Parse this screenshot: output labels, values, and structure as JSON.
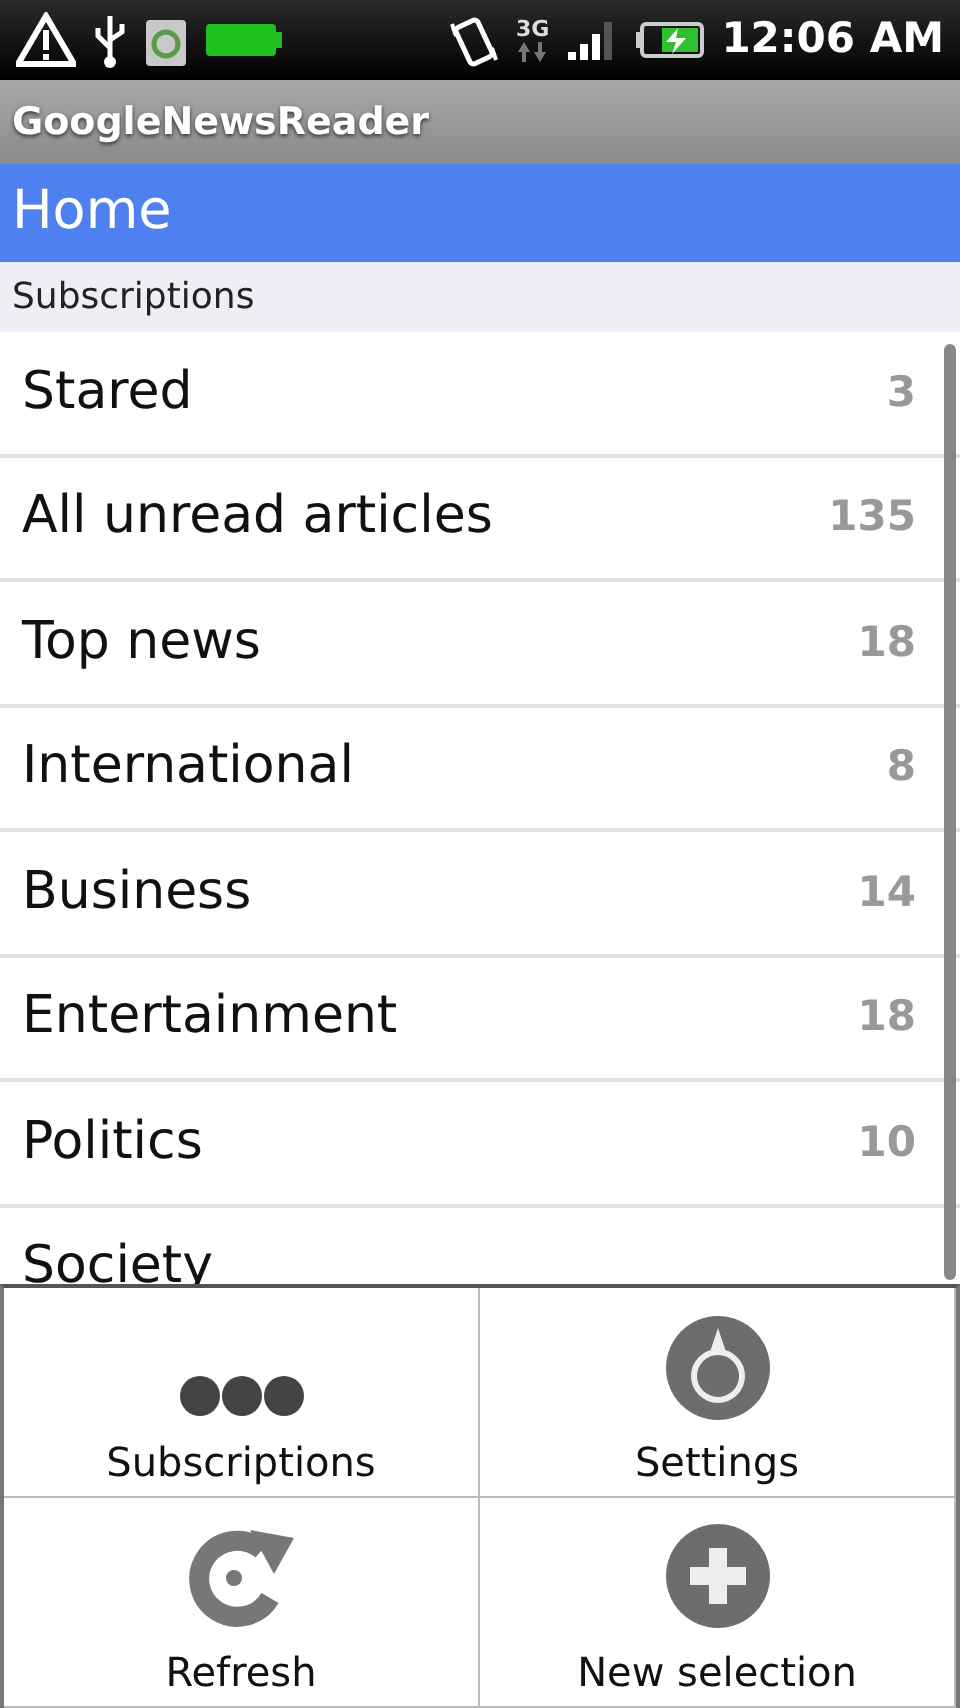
{
  "status_bar": {
    "network": "3G",
    "time": "12:06 AM"
  },
  "app_title": "GoogleNewsReader",
  "header": "Home",
  "section": "Subscriptions",
  "subscriptions": [
    {
      "name": "Stared",
      "count": "3"
    },
    {
      "name": "All unread articles",
      "count": "135"
    },
    {
      "name": "Top news",
      "count": "18"
    },
    {
      "name": "International",
      "count": "8"
    },
    {
      "name": "Business",
      "count": "14"
    },
    {
      "name": "Entertainment",
      "count": "18"
    },
    {
      "name": "Politics",
      "count": "10"
    },
    {
      "name": "Society"
    }
  ],
  "menu": [
    {
      "label": "Subscriptions",
      "kind": "more"
    },
    {
      "label": "Settings",
      "kind": "settings"
    },
    {
      "label": "Refresh",
      "kind": "refresh"
    },
    {
      "label": "New selection",
      "kind": "add"
    }
  ]
}
